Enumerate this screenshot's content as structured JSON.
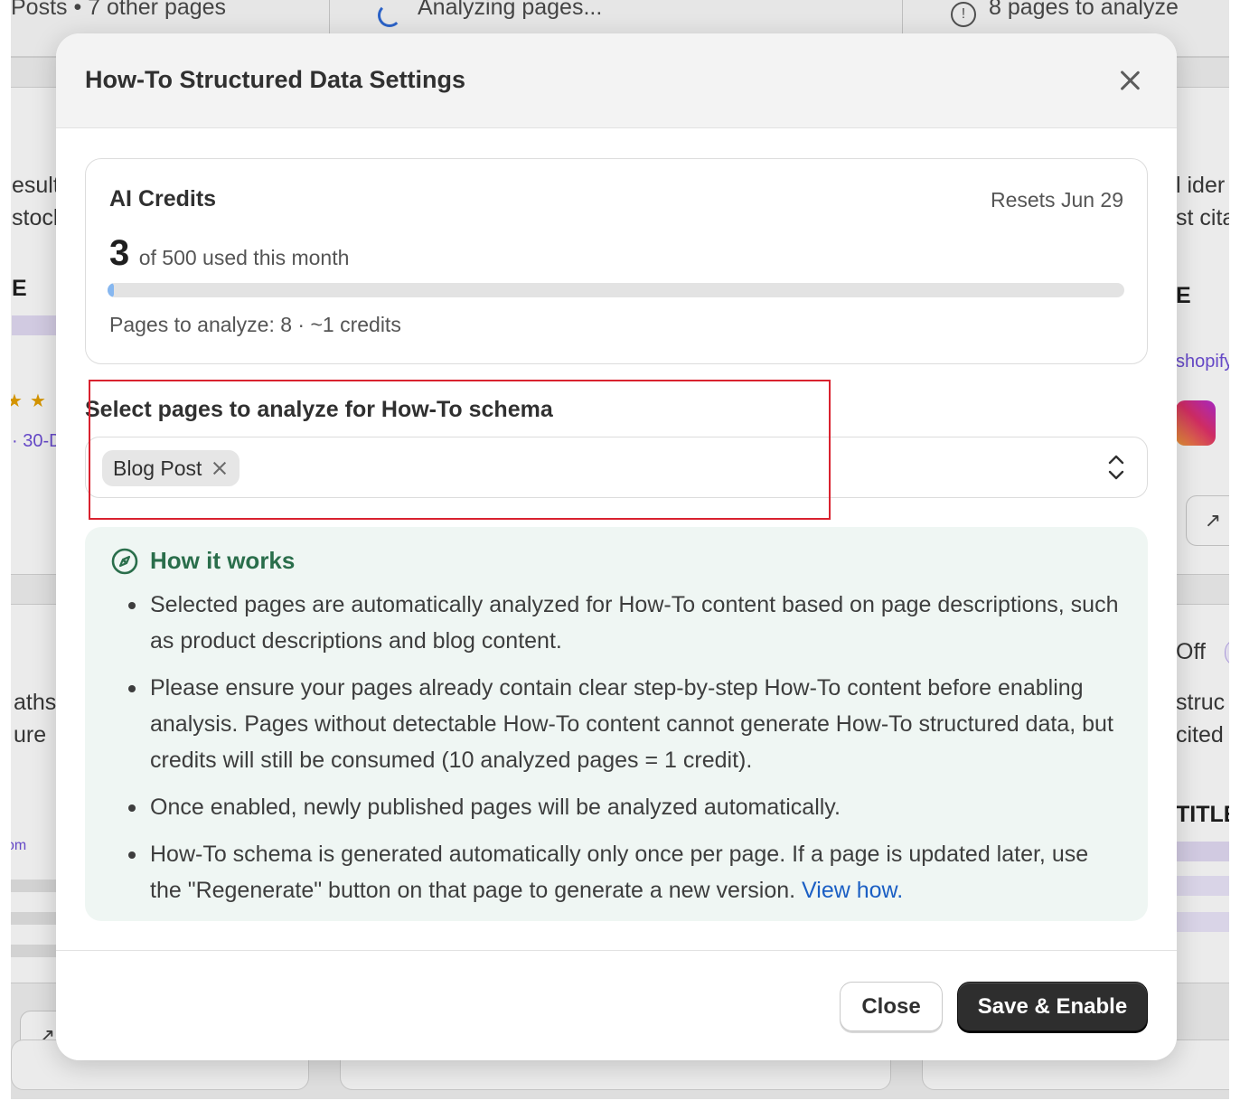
{
  "background": {
    "top_bar": {
      "left_text": "Posts • 7 other pages",
      "middle_text": "Analyzing pages...",
      "right_text": "8 pages to analyze"
    },
    "left_fragments": [
      "esult",
      "stock",
      "E",
      "· 30-D",
      "aths",
      "ure",
      "om"
    ],
    "right_fragments": [
      "l ider",
      "st cita",
      "E",
      "shopify",
      "Off",
      "struc",
      "cited",
      "TITLE"
    ]
  },
  "modal": {
    "title": "How-To Structured Data Settings",
    "credits": {
      "title": "AI Credits",
      "resets": "Resets Jun 29",
      "used": "3",
      "used_text": "of 500 used this month",
      "used_fraction": 0.006,
      "pages_line": "Pages to analyze: 8 · ~1 credits"
    },
    "select": {
      "label": "Select pages to analyze for How-To schema",
      "tags": [
        "Blog Post"
      ]
    },
    "info": {
      "title": "How it works",
      "items": [
        "Selected pages are automatically analyzed for How-To content based on page descriptions, such as product descriptions and blog content.",
        "Please ensure your pages already contain clear step-by-step How-To content before enabling analysis. Pages without detectable How-To content cannot generate How-To structured data, but credits will still be consumed (10 analyzed pages = 1 credit).",
        "Once enabled, newly published pages will be analyzed automatically.",
        "How-To schema is generated automatically only once per page. If a page is updated later, use the \"Regenerate\" button on that page to generate a new version."
      ],
      "link_text": "View how."
    },
    "footer": {
      "close_label": "Close",
      "save_label": "Save & Enable"
    }
  },
  "colors": {
    "accent_green": "#2a6e4b",
    "link_blue": "#1b5fc4",
    "primary_button": "#2e2e2e",
    "highlight_red": "#d9222f",
    "progress_fill": "#86b7f0"
  },
  "icons": {
    "close": "close-icon",
    "tag_remove": "tag-remove-icon",
    "select_chevrons": "chevron-up-down-icon",
    "info": "compass-icon"
  }
}
